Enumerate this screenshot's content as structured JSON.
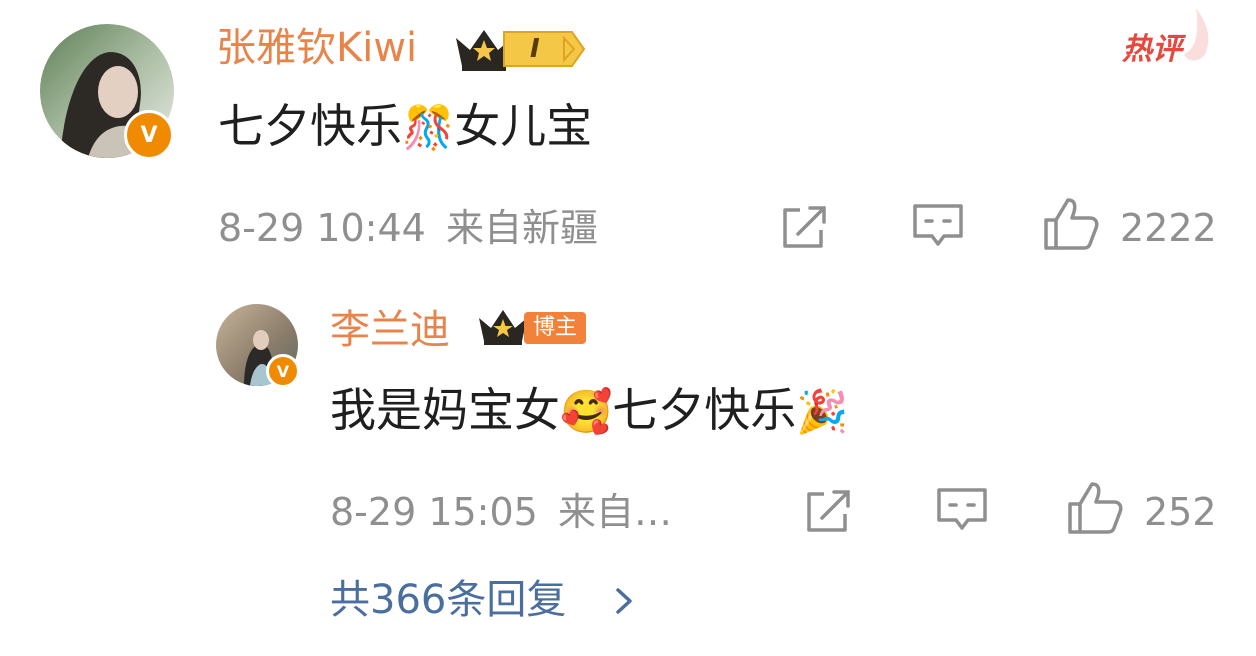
{
  "comments": [
    {
      "username": "张雅钦Kiwi",
      "level_label": "I",
      "text": "七夕快乐",
      "text_suffix": "女儿宝",
      "emoji_1": "🎊",
      "date": "8-29 10:44",
      "location": "来自新疆",
      "likes": "2222",
      "hot_label": "热评"
    },
    {
      "username": "李兰迪",
      "badge_label": "博主",
      "text": "我是妈宝女",
      "text_mid": "七夕快乐",
      "emoji_1": "🥰",
      "emoji_2": "🎉",
      "date": "8-29 15:05",
      "location": "来自…",
      "likes": "252"
    }
  ],
  "replies_link": "共366条回复",
  "colors": {
    "username": "#e8844a",
    "meta": "#8f8f8f",
    "link": "#4a6f9f",
    "hot": "#e8473d"
  },
  "icons": [
    "verified-v-icon",
    "crown-icon",
    "share-icon",
    "comment-icon",
    "thumbs-up-icon",
    "chevron-right-icon"
  ]
}
